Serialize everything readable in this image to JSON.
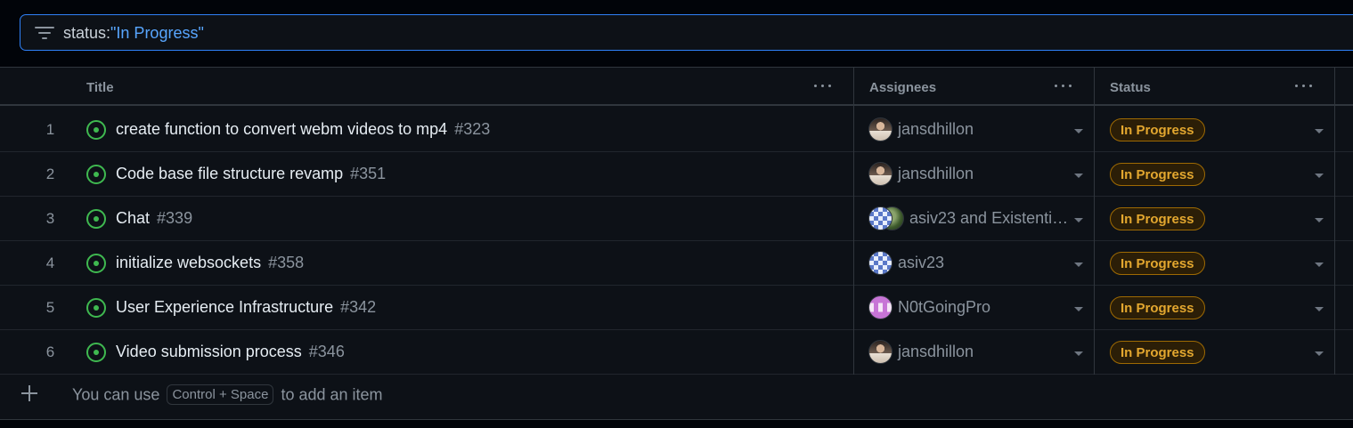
{
  "filter": {
    "key": "status:",
    "value": "\"In Progress\"",
    "icon": "filter-icon"
  },
  "columns": {
    "title": "Title",
    "assignees": "Assignees",
    "status": "Status"
  },
  "rows": [
    {
      "num": "1",
      "title": "create function to convert webm videos to mp4",
      "issue": "#323",
      "assignee": "jansdhillon",
      "status": "In Progress"
    },
    {
      "num": "2",
      "title": "Code base file structure revamp",
      "issue": "#351",
      "assignee": "jansdhillon",
      "status": "In Progress"
    },
    {
      "num": "3",
      "title": "Chat",
      "issue": "#339",
      "assignee": "asiv23 and Existenti…",
      "status": "In Progress"
    },
    {
      "num": "4",
      "title": "initialize websockets",
      "issue": "#358",
      "assignee": "asiv23",
      "status": "In Progress"
    },
    {
      "num": "5",
      "title": "User Experience Infrastructure",
      "issue": "#342",
      "assignee": "N0tGoingPro",
      "status": "In Progress"
    },
    {
      "num": "6",
      "title": "Video submission process",
      "issue": "#346",
      "assignee": "jansdhillon",
      "status": "In Progress"
    }
  ],
  "add_item": {
    "prefix": "You can use",
    "shortcut": "Control + Space",
    "suffix": "to add an item"
  },
  "colors": {
    "accent": "#2f81f7",
    "open_issue": "#3fb950",
    "in_progress": "#e3a72f",
    "background": "#0d1117"
  }
}
